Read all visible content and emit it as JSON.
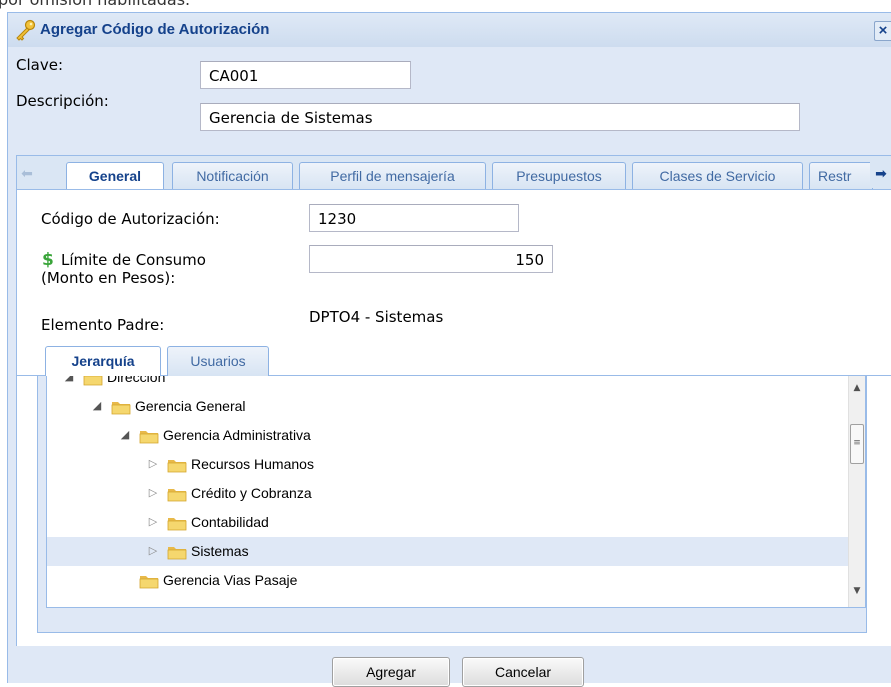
{
  "background_text": "por omisión habilitadas.",
  "window": {
    "title": "Agregar Código de Autorización",
    "close_glyph": "×",
    "title_icon": "key-icon"
  },
  "form": {
    "clave_label": "Clave:",
    "clave_value": "CA001",
    "descripcion_label": "Descripción:",
    "descripcion_value": "Gerencia de Sistemas"
  },
  "tabs": [
    {
      "label": "General",
      "active": true
    },
    {
      "label": "Notificación",
      "active": false
    },
    {
      "label": "Perfil de mensajería",
      "active": false
    },
    {
      "label": "Presupuestos",
      "active": false
    },
    {
      "label": "Clases de Servicio",
      "active": false
    },
    {
      "label": "Restr",
      "active": false
    }
  ],
  "general": {
    "codigo_label": "Código de Autorización:",
    "codigo_value": "1230",
    "limite_label_line1": "Límite de Consumo",
    "limite_label_line2": "(Monto en Pesos):",
    "limite_value": "150",
    "limite_icon": "dollar-icon",
    "padre_label": "Elemento Padre:",
    "padre_value": "DPTO4 - Sistemas"
  },
  "subtabs": [
    {
      "label": "Jerarquía",
      "active": true
    },
    {
      "label": "Usuarios",
      "active": false
    }
  ],
  "tree": [
    {
      "label": "Dirección",
      "level": 0,
      "expanded": true,
      "selected": false
    },
    {
      "label": "Gerencia General",
      "level": 1,
      "expanded": true,
      "selected": false
    },
    {
      "label": "Gerencia Administrativa",
      "level": 2,
      "expanded": true,
      "selected": false
    },
    {
      "label": "Recursos Humanos",
      "level": 3,
      "expanded": false,
      "selected": false
    },
    {
      "label": "Crédito y Cobranza",
      "level": 3,
      "expanded": false,
      "selected": false
    },
    {
      "label": "Contabilidad",
      "level": 3,
      "expanded": false,
      "selected": false
    },
    {
      "label": "Sistemas",
      "level": 3,
      "expanded": false,
      "selected": true
    },
    {
      "label": "Gerencia Vias Pasaje",
      "level": 2,
      "expanded": null,
      "selected": false
    }
  ],
  "buttons": {
    "agregar": "Agregar",
    "cancelar": "Cancelar"
  },
  "colors": {
    "window_bg": "#dfe8f6",
    "title_color": "#15428b",
    "selected_row": "#dfe8f6",
    "dollar_green": "#3aa53a",
    "folder_yellow": "#f5d76e"
  }
}
